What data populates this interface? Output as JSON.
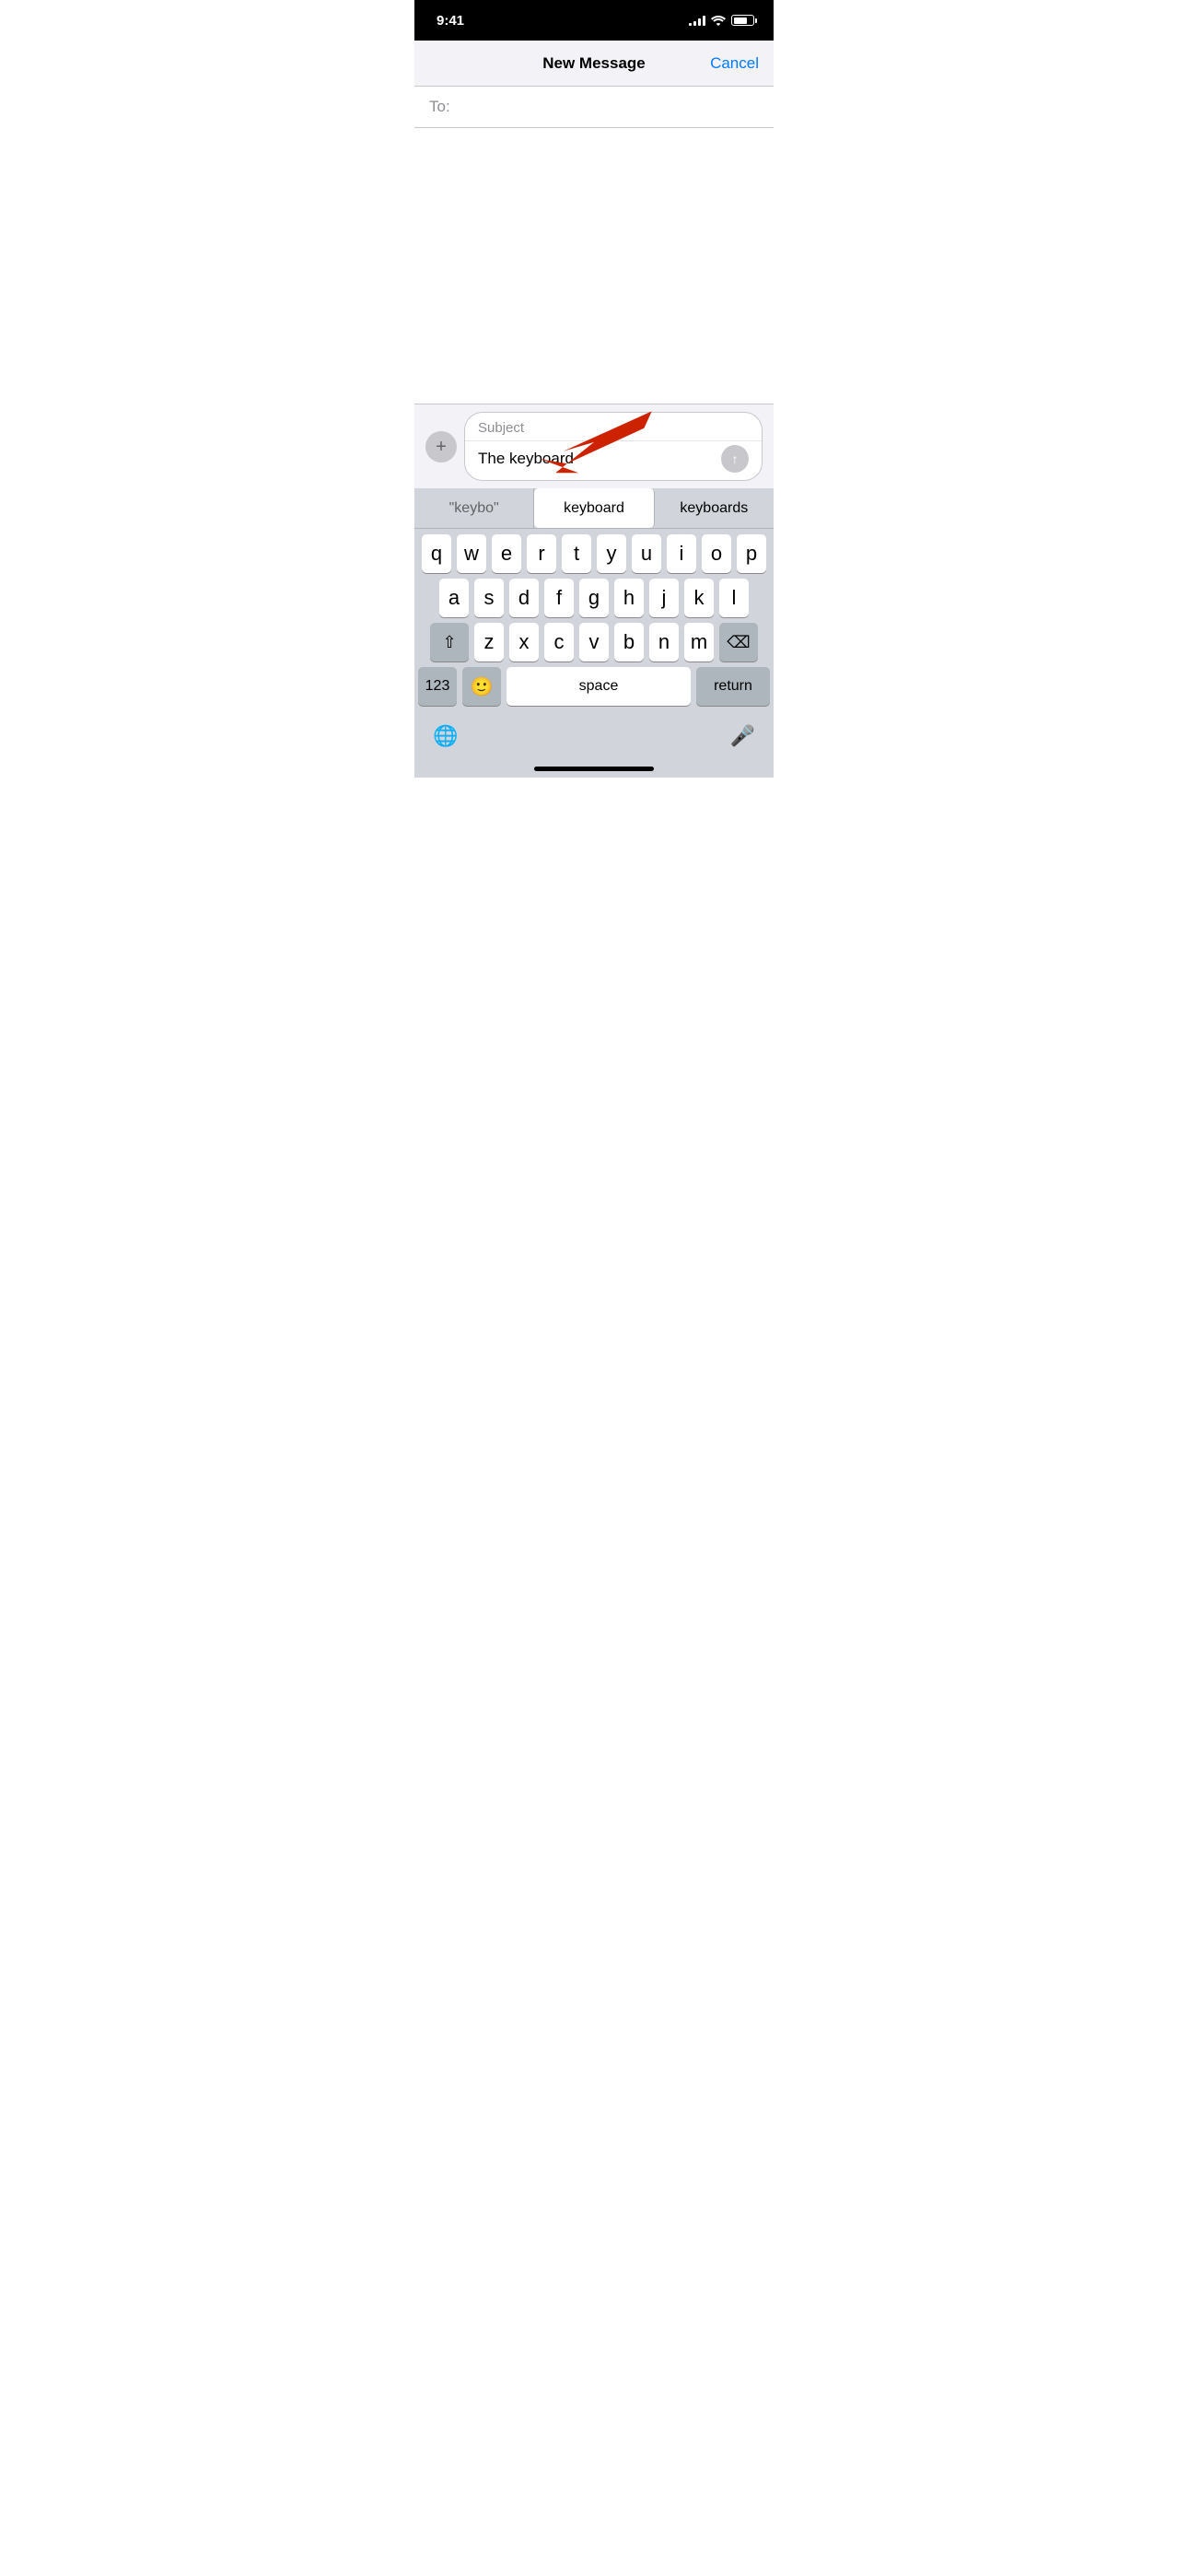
{
  "statusBar": {
    "time": "9:41"
  },
  "navBar": {
    "title": "New Message",
    "cancelLabel": "Cancel"
  },
  "toField": {
    "label": "To:"
  },
  "messageInput": {
    "subjectPlaceholder": "Subject",
    "messageText": "The keyboard",
    "addButtonLabel": "+",
    "sendButtonLabel": "↑"
  },
  "autocomplete": {
    "items": [
      {
        "label": "\"keybo\"",
        "type": "quoted"
      },
      {
        "label": "keyboard",
        "type": "selected"
      },
      {
        "label": "keyboards",
        "type": "normal"
      }
    ]
  },
  "keyboard": {
    "row1": [
      "q",
      "w",
      "e",
      "r",
      "t",
      "y",
      "u",
      "i",
      "o",
      "p"
    ],
    "row2": [
      "a",
      "s",
      "d",
      "f",
      "g",
      "h",
      "j",
      "k",
      "l"
    ],
    "row3": [
      "z",
      "x",
      "c",
      "v",
      "b",
      "n",
      "m"
    ],
    "spaceLabel": "space",
    "returnLabel": "return",
    "numberLabel": "123",
    "deleteLabel": "⌫",
    "shiftLabel": "⇧",
    "globeLabel": "🌐",
    "micLabel": "🎤"
  }
}
